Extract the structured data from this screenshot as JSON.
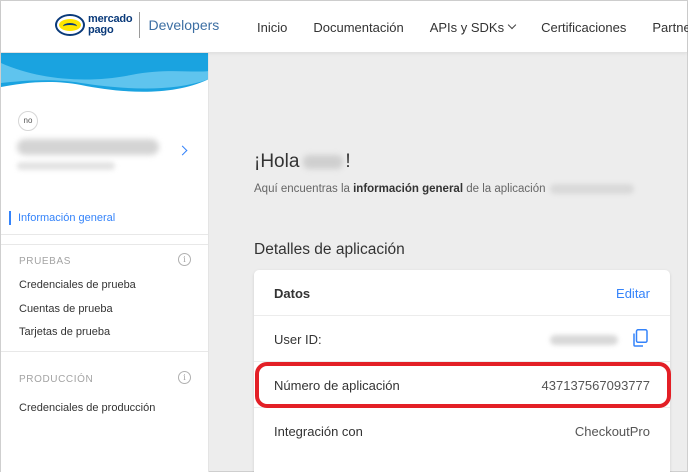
{
  "header": {
    "logo_line1": "mercado",
    "logo_line2": "pago",
    "logo_product": "Developers",
    "nav": [
      {
        "label": "Inicio"
      },
      {
        "label": "Documentación"
      },
      {
        "label": "APIs y SDKs"
      },
      {
        "label": "Certificaciones"
      },
      {
        "label": "Partner"
      }
    ]
  },
  "sidebar": {
    "avatar_initials": "no",
    "active_item": "Información general",
    "sections": [
      {
        "title": "PRUEBAS",
        "items": [
          "Credenciales de prueba",
          "Cuentas de prueba",
          "Tarjetas de prueba"
        ]
      },
      {
        "title": "PRODUCCIÓN",
        "items": [
          "Credenciales de producción"
        ]
      }
    ]
  },
  "main": {
    "greeting_prefix": "¡Hola",
    "greeting_suffix": "!",
    "intro_prefix": "Aquí encuentras la",
    "intro_bold": "información general",
    "intro_suffix": "de la aplicación",
    "section_title": "Detalles de aplicación",
    "card": {
      "header_label": "Datos",
      "edit_label": "Editar",
      "rows": [
        {
          "label": "User ID:",
          "value": ""
        },
        {
          "label": "Número de aplicación",
          "value": "437137567093777"
        },
        {
          "label": "Integración con",
          "value": "CheckoutPro"
        }
      ]
    }
  },
  "colors": {
    "accent": "#3483fa",
    "highlight": "#e31f26",
    "brand_dark": "#0a3a7a",
    "brand_yellow": "#ffe600"
  }
}
